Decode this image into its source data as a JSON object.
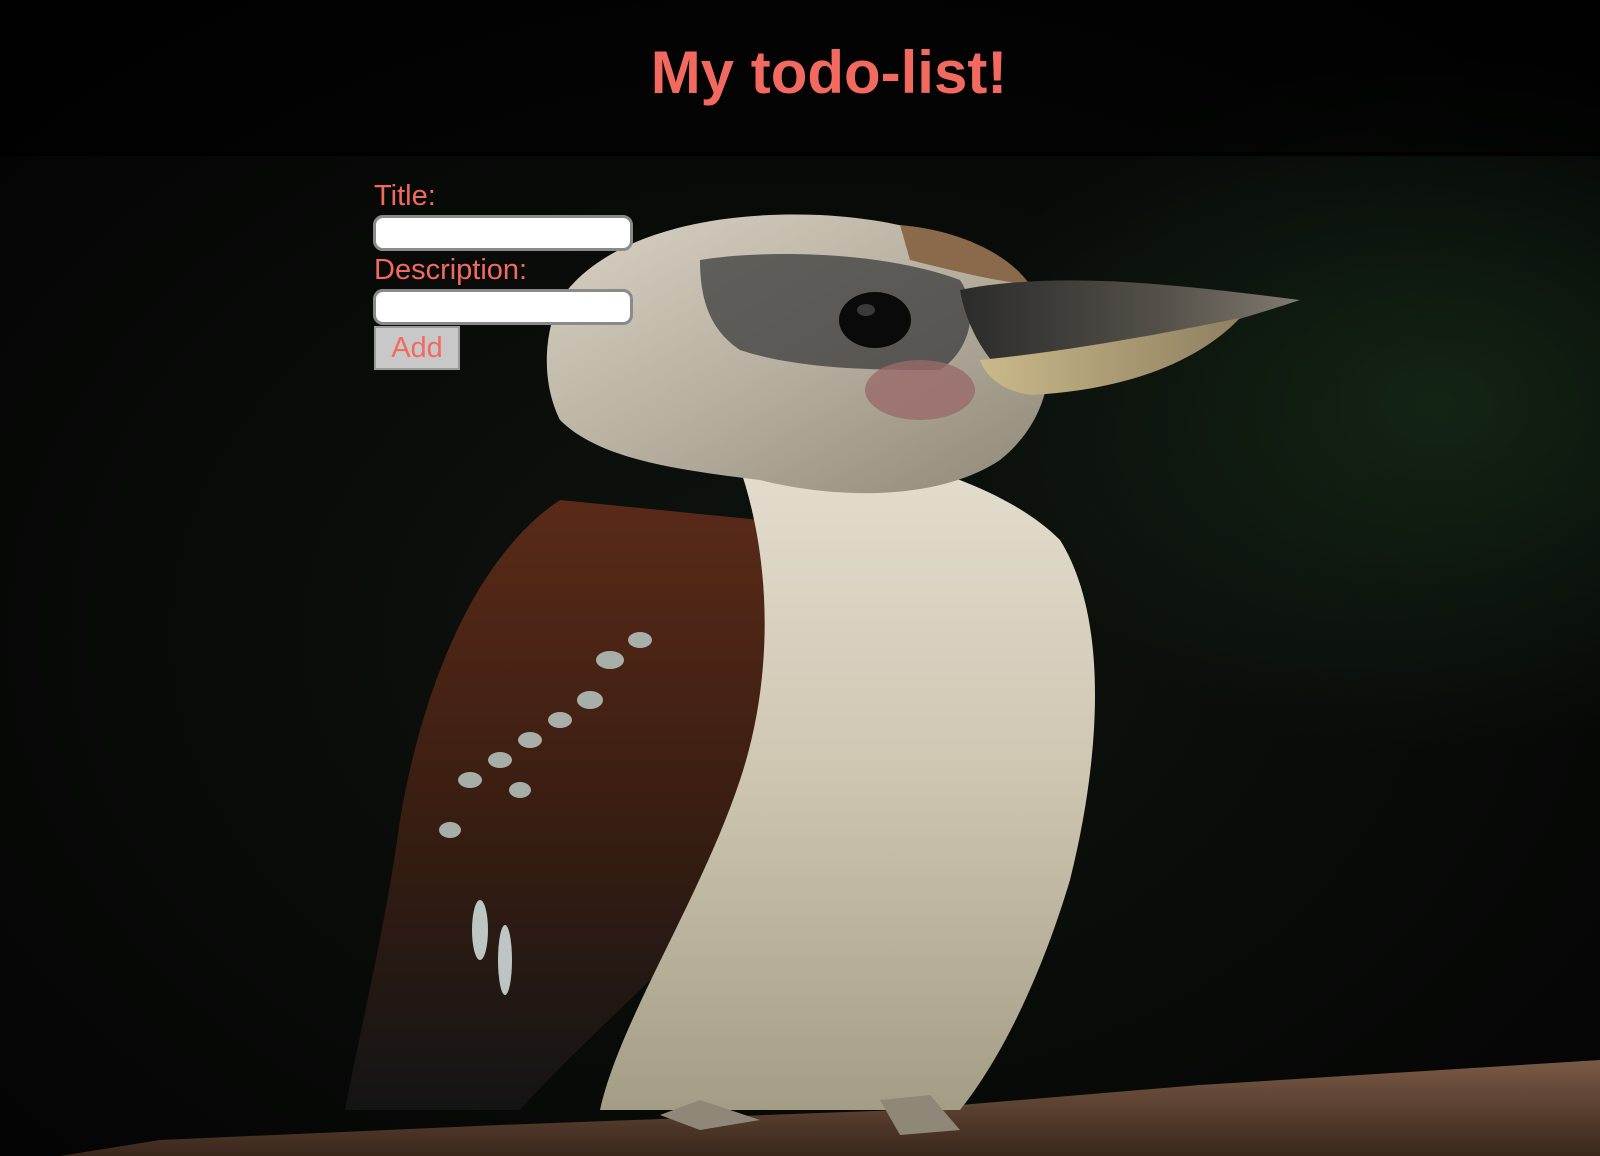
{
  "header": {
    "title": "My todo-list!"
  },
  "form": {
    "title_label": "Title:",
    "title_value": "",
    "description_label": "Description:",
    "description_value": "",
    "add_label": "Add"
  },
  "colors": {
    "accent": "#f26a5f",
    "background": "#050505",
    "button_bg": "#c8c8c8"
  },
  "background_image": "kookaburra-photo"
}
